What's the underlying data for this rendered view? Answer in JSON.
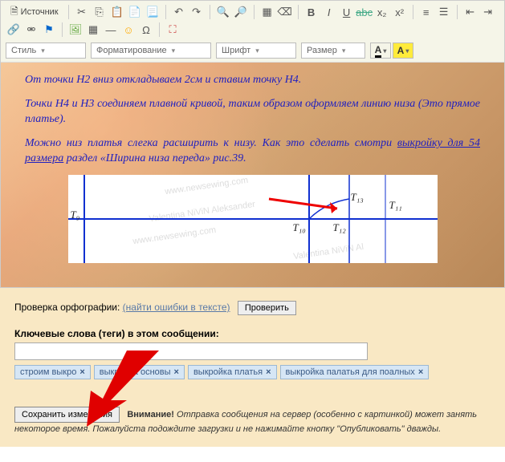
{
  "toolbar": {
    "source_label": "Источник",
    "style_label": "Стиль",
    "format_label": "Форматирование",
    "font_label": "Шрифт",
    "size_label": "Размер"
  },
  "content": {
    "p1": "От точки Н2 вниз откладываем 2см и ставим точку Н4.",
    "p2_a": "Точки Н4 и Н3  соединяем плавной кривой, таким образом оформляем линию низа (Это прямое платье).",
    "p3_a": "Можно низ платья слегка расширить к низу. Как это сделать смотри ",
    "p3_link": "выкройку для 54 размера",
    "p3_b": " раздел «Ширина низа переда» рис.39."
  },
  "diagram": {
    "watermarks": [
      "www.newsewing.com",
      "Valentina NiViN Aleksander",
      "www.newsewing.com",
      "Valentina NiViN Al"
    ],
    "labels": {
      "t9": "T₉",
      "t10": "T₁₀",
      "t12": "T₁₂",
      "t13": "T₁₃",
      "t11": "T₁₁"
    }
  },
  "spellcheck": {
    "label": "Проверка орфографии: ",
    "link": "(найти ошибки в тексте)",
    "button": "Проверить"
  },
  "tags": {
    "label": "Ключевые слова (теги) в этом сообщении:",
    "input_value": "",
    "items": [
      "строим выкро",
      "выкройка основы",
      "выкройка платья",
      "выкройка палатья для поалных"
    ]
  },
  "submit": {
    "save_button": "Сохранить изменения",
    "warning_bold": "Внимание!",
    "warning_text": " Отправка сообщения на сервер (особенно с картинкой) может занять некоторое время. Пожалуйста подождите загрузки и не нажимайте кнопку \"Опубликовать\" дважды."
  }
}
